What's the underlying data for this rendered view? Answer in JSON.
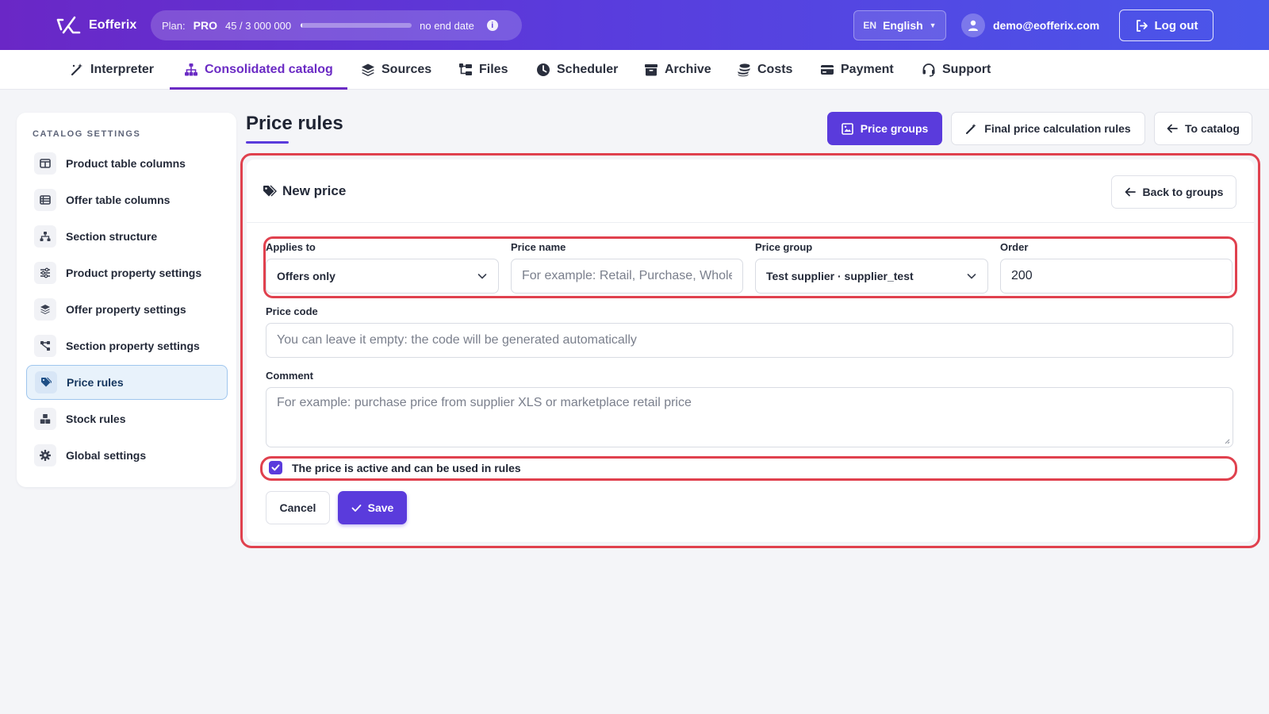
{
  "app": {
    "name": "Eofferix",
    "plan_label": "Plan:",
    "plan_tier": "PRO",
    "plan_usage": "45  /  3 000 000",
    "plan_usage_fraction": 1.5e-05,
    "plan_end": "no end date",
    "language_code": "EN",
    "language_name": "English",
    "user_email": "demo@eofferix.com",
    "logout_label": "Log out"
  },
  "nav": {
    "items": [
      {
        "label": "Interpreter",
        "icon": "magic-wand-icon"
      },
      {
        "label": "Consolidated catalog",
        "icon": "sitemap-icon",
        "active": true
      },
      {
        "label": "Sources",
        "icon": "layers-icon"
      },
      {
        "label": "Files",
        "icon": "folder-tree-icon"
      },
      {
        "label": "Scheduler",
        "icon": "clock-icon"
      },
      {
        "label": "Archive",
        "icon": "archive-box-icon"
      },
      {
        "label": "Costs",
        "icon": "coins-icon"
      },
      {
        "label": "Payment",
        "icon": "credit-card-icon"
      },
      {
        "label": "Support",
        "icon": "headset-icon"
      }
    ]
  },
  "sidebar": {
    "title": "CATALOG SETTINGS",
    "items": [
      {
        "label": "Product table columns",
        "icon": "columns-icon"
      },
      {
        "label": "Offer table columns",
        "icon": "table-list-icon"
      },
      {
        "label": "Section structure",
        "icon": "hierarchy-icon"
      },
      {
        "label": "Product property settings",
        "icon": "sliders-icon"
      },
      {
        "label": "Offer property settings",
        "icon": "layers-icon"
      },
      {
        "label": "Section property settings",
        "icon": "share-nodes-icon"
      },
      {
        "label": "Price rules",
        "icon": "tags-icon",
        "active": true
      },
      {
        "label": "Stock rules",
        "icon": "boxes-icon"
      },
      {
        "label": "Global settings",
        "icon": "gear-icon"
      }
    ]
  },
  "page": {
    "title": "Price rules",
    "buttons": {
      "price_groups": "Price groups",
      "final_rules": "Final price calculation rules",
      "to_catalog": "To catalog"
    }
  },
  "form": {
    "title": "New price",
    "back_label": "Back to groups",
    "applies_to": {
      "label": "Applies to",
      "value": "Offers only"
    },
    "price_name": {
      "label": "Price name",
      "placeholder": "For example: Retail, Purchase, Wholesale"
    },
    "price_group": {
      "label": "Price group",
      "value": "Test supplier · supplier_test"
    },
    "order": {
      "label": "Order",
      "value": "200"
    },
    "price_code": {
      "label": "Price code",
      "placeholder": "You can leave it empty: the code will be generated automatically"
    },
    "comment": {
      "label": "Comment",
      "placeholder": "For example: purchase price from supplier XLS or marketplace retail price"
    },
    "active": {
      "label": "The price is active and can be used in rules",
      "checked": true
    },
    "cancel_label": "Cancel",
    "save_label": "Save"
  },
  "colors": {
    "accent": "#5a3bdc",
    "nav_active": "#6b2bc4",
    "highlight": "#e0414e",
    "sidebar_active_bg": "#e8f2fb"
  }
}
